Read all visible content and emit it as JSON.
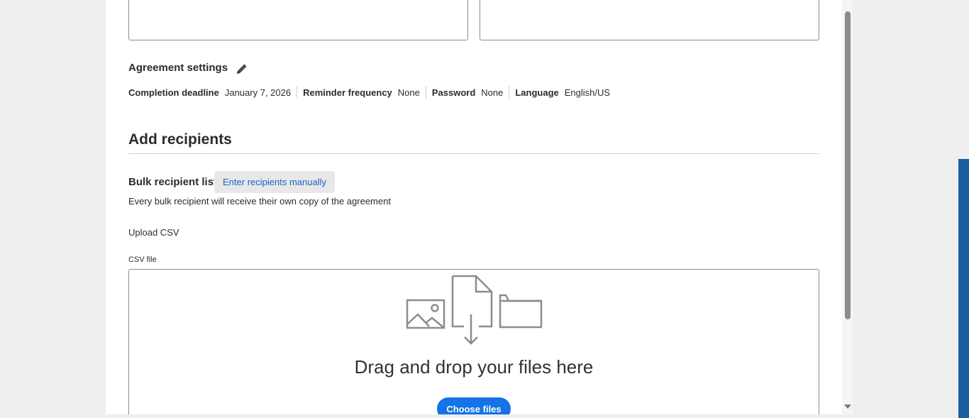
{
  "agreement_settings": {
    "title": "Agreement settings",
    "edit_icon": "pencil-icon",
    "items": [
      {
        "label": "Completion deadline",
        "value": "January 7, 2026"
      },
      {
        "label": "Reminder frequency",
        "value": "None"
      },
      {
        "label": "Password",
        "value": "None"
      },
      {
        "label": "Language",
        "value": "English/US"
      }
    ]
  },
  "recipients": {
    "title": "Add recipients",
    "bulk_label": "Bulk recipient list",
    "manual_button": "Enter recipients manually",
    "description": "Every bulk recipient will receive their own copy of the agreement"
  },
  "upload": {
    "heading": "Upload CSV",
    "field_label": "CSV file",
    "drop_text": "Drag and drop your files here",
    "choose_button": "Choose files",
    "illustration_icons": [
      "image-icon",
      "file-download-icon",
      "folder-icon"
    ]
  },
  "colors": {
    "accent": "#1473e6",
    "link": "#1a63c9",
    "right_accent": "#1b5ea1"
  }
}
